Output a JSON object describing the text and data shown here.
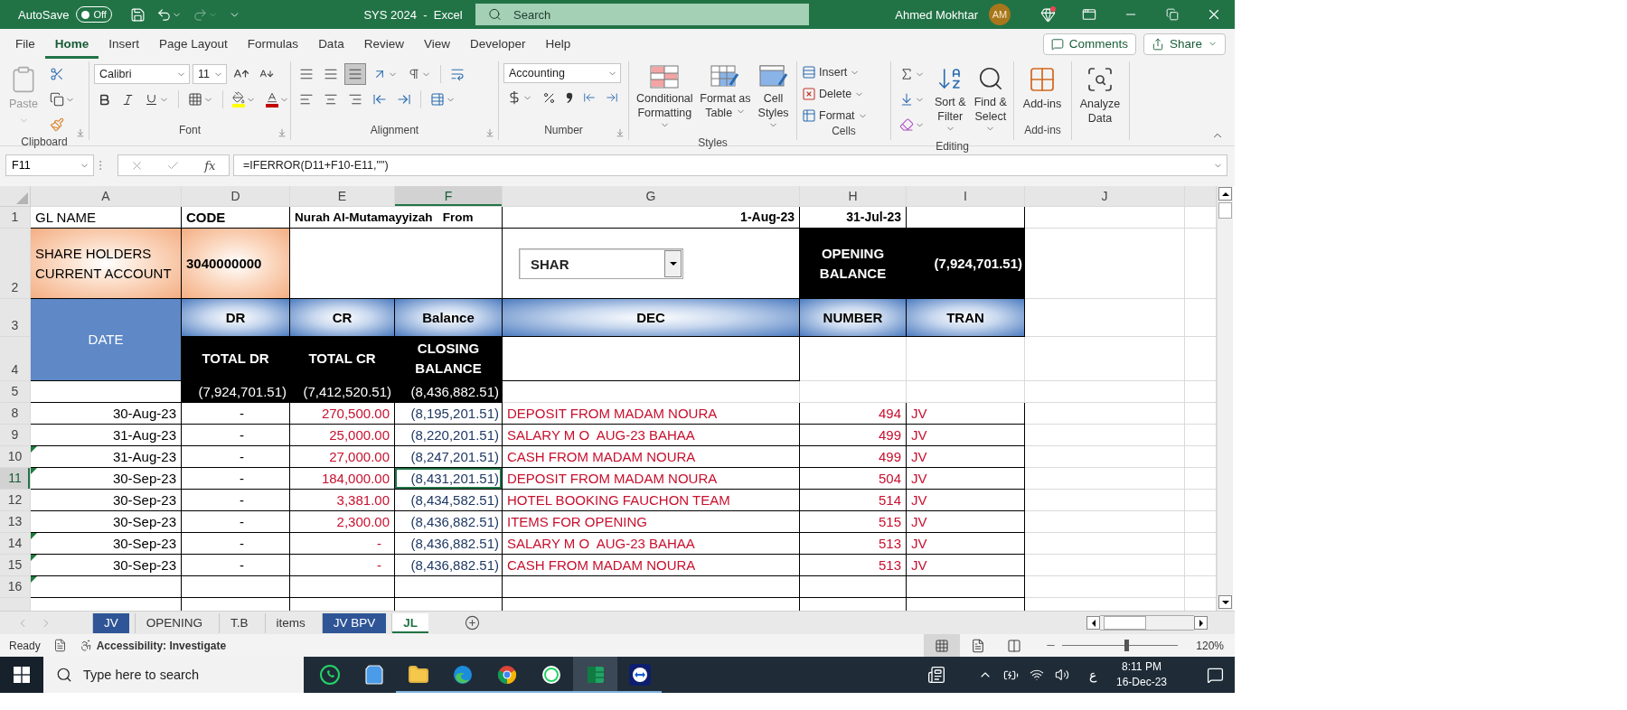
{
  "title_bar": {
    "autosave_label": "AutoSave",
    "autosave": {
      "label": "Off",
      "on": false
    },
    "redo_disabled": true,
    "title": "SYS 2024  -  Excel",
    "search": {
      "placeholder": "Search"
    },
    "user": "Ahmed Mokhtar",
    "avatar": "AM",
    "notification": true
  },
  "menu": [
    {
      "label": "File",
      "selected": false
    },
    {
      "label": "Home",
      "selected": true
    },
    {
      "label": "Insert",
      "selected": false
    },
    {
      "label": "Page Layout",
      "selected": false
    },
    {
      "label": "Formulas",
      "selected": false
    },
    {
      "label": "Data",
      "selected": false
    },
    {
      "label": "Review",
      "selected": false
    },
    {
      "label": "View",
      "selected": false
    },
    {
      "label": "Developer",
      "selected": false
    },
    {
      "label": "Help",
      "selected": false
    }
  ],
  "comments": "Comments",
  "share": "Share",
  "ribbon": {
    "groups": [
      {
        "kind": "clipboard",
        "label": "Clipboard",
        "buttons": [
          "Paste"
        ]
      },
      {
        "kind": "font",
        "label": "Font",
        "font": "Calibri",
        "size": "11"
      },
      {
        "kind": "alignment",
        "label": "Alignment",
        "vertical": [
          {
            "selected": false
          },
          {
            "selected": false
          },
          {
            "selected": true
          }
        ]
      },
      {
        "kind": "number",
        "label": "Number",
        "format": "Accounting"
      },
      {
        "kind": "styles",
        "label": "Styles",
        "buttons": [
          "Conditional Formatting",
          "Format as Table",
          "Cell Styles"
        ]
      },
      {
        "kind": "cells",
        "label": "Cells",
        "buttons": [
          "Insert",
          "Delete",
          "Format"
        ]
      },
      {
        "kind": "editing",
        "label": "Editing",
        "buttons": [
          "Sort & Filter",
          "Find & Select"
        ]
      },
      {
        "kind": "addins",
        "label": "Add-ins",
        "buttons": [
          "Add-ins"
        ]
      },
      {
        "kind": "analyze",
        "buttons": [
          "Analyze Data"
        ]
      }
    ]
  },
  "formula_bar": {
    "name_box": "F11",
    "fx": "fx",
    "formula": "=IFERROR(D11+F10-E11,\"\")"
  },
  "sheet": {
    "columns": [
      {
        "label": "A",
        "selected": false
      },
      {
        "label": "D",
        "selected": false
      },
      {
        "label": "E",
        "selected": false
      },
      {
        "label": "F",
        "selected": true
      },
      {
        "label": "G",
        "selected": false
      },
      {
        "label": "H",
        "selected": false
      },
      {
        "label": "I",
        "selected": false
      },
      {
        "label": "J",
        "selected": false
      }
    ],
    "header": {
      "row_numbers": [
        "1",
        "2",
        "3",
        "4",
        "5"
      ],
      "gl_name_label": "GL NAME",
      "code_label": "CODE",
      "company": "Nurah Al-Mutamayyizah   From",
      "from_date": "1-Aug-23",
      "to_date": "31-Jul-23",
      "gl_name": "SHARE HOLDERS CURRENT ACCOUNT",
      "code": "3040000000",
      "dropdown": "SHAR",
      "opening_label": "OPENING BALANCE",
      "opening_balance": "(7,924,701.51)"
    },
    "table_headers": {
      "date": "DATE",
      "dr": "DR",
      "cr": "CR",
      "balance": "Balance",
      "desc": "DEC",
      "number": "NUMBER",
      "tran": "TRAN",
      "total_dr": "TOTAL DR",
      "total_cr": "TOTAL CR",
      "closing": "CLOSING BALANCE"
    },
    "totals": {
      "dr": "(7,924,701.51)",
      "cr": "(7,412,520.51)",
      "closing": "(8,436,882.51)"
    },
    "entries": [
      {
        "row": "8",
        "date": "30-Aug-23",
        "dr": "-",
        "cr": "270,500.00",
        "balance": "(8,195,201.51)",
        "desc": "DEPOSIT FROM MADAM NOURA",
        "number": "494",
        "tran": "JV",
        "flag": false,
        "selected": false
      },
      {
        "row": "9",
        "date": "31-Aug-23",
        "dr": "-",
        "cr": "25,000.00",
        "balance": "(8,220,201.51)",
        "desc": "SALARY M O  AUG-23 BAHAA",
        "number": "499",
        "tran": "JV",
        "flag": false,
        "selected": false
      },
      {
        "row": "10",
        "date": "31-Aug-23",
        "dr": "-",
        "cr": "27,000.00",
        "balance": "(8,247,201.51)",
        "desc": "CASH FROM MADAM NOURA",
        "number": "499",
        "tran": "JV",
        "flag": true,
        "selected": false
      },
      {
        "row": "11",
        "date": "30-Sep-23",
        "dr": "-",
        "cr": "184,000.00",
        "balance": "(8,431,201.51)",
        "desc": "DEPOSIT FROM MADAM NOURA",
        "number": "504",
        "tran": "JV",
        "flag": true,
        "selected": true
      },
      {
        "row": "12",
        "date": "30-Sep-23",
        "dr": "-",
        "cr": "3,381.00",
        "balance": "(8,434,582.51)",
        "desc": "HOTEL BOOKING FAUCHON TEAM",
        "number": "514",
        "tran": "JV",
        "flag": false,
        "selected": false
      },
      {
        "row": "13",
        "date": "30-Sep-23",
        "dr": "-",
        "cr": "2,300.00",
        "balance": "(8,436,882.51)",
        "desc": "ITEMS FOR OPENING",
        "number": "515",
        "tran": "JV",
        "flag": false,
        "selected": false
      },
      {
        "row": "14",
        "date": "30-Sep-23",
        "dr": "-",
        "cr": "-",
        "balance": "(8,436,882.51)",
        "desc": "SALARY M O  AUG-23 BAHAA",
        "number": "513",
        "tran": "JV",
        "flag": true,
        "selected": false
      },
      {
        "row": "15",
        "date": "30-Sep-23",
        "dr": "-",
        "cr": "-",
        "balance": "(8,436,882.51)",
        "desc": "CASH FROM MADAM NOURA",
        "number": "513",
        "tran": "JV",
        "flag": true,
        "selected": false
      }
    ],
    "blank_rows": [
      {
        "row": "16",
        "flag": true
      }
    ]
  },
  "sheet_tabs": [
    {
      "label": "JV",
      "selected": false,
      "color": "#2f5597"
    },
    {
      "label": "OPENING",
      "selected": false
    },
    {
      "label": "T.B",
      "selected": false
    },
    {
      "label": "items",
      "selected": false
    },
    {
      "label": "JV BPV",
      "selected": false,
      "color": "#2f5597"
    },
    {
      "label": "JL",
      "selected": true
    }
  ],
  "status_bar": {
    "mode": "Ready",
    "accessibility": "Accessibility: Investigate",
    "views": [
      {
        "kind": "normal",
        "selected": true
      },
      {
        "kind": "page-layout",
        "selected": false
      },
      {
        "kind": "page-break",
        "selected": false
      }
    ],
    "zoom": {
      "level": 0.55,
      "label": "120%"
    }
  },
  "taskbar": {
    "search": {
      "placeholder": "Type here to search"
    },
    "apps": [
      {
        "kind": "whatsapp",
        "running": false,
        "active": false
      },
      {
        "kind": "store",
        "running": false,
        "active": false
      },
      {
        "kind": "explorer",
        "running": true,
        "active": false
      },
      {
        "kind": "edge",
        "running": true,
        "active": false
      },
      {
        "kind": "chrome",
        "running": true,
        "active": false
      },
      {
        "kind": "whatsapp-web",
        "running": true,
        "active": false
      },
      {
        "kind": "excel",
        "running": true,
        "active": true
      },
      {
        "kind": "teamviewer",
        "running": true,
        "active": false
      }
    ],
    "language": "ع",
    "time": "8:11 PM",
    "date": "16-Dec-23"
  }
}
